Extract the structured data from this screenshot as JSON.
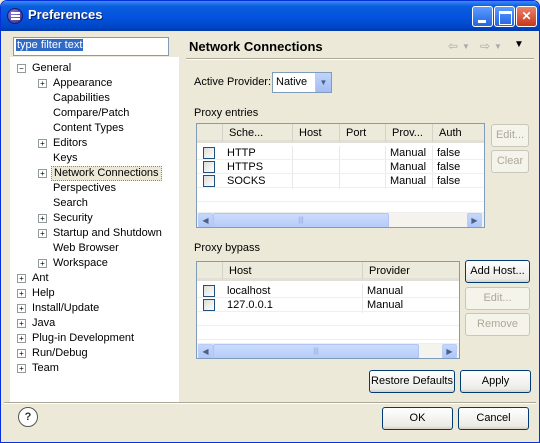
{
  "window": {
    "title": "Preferences"
  },
  "filter": {
    "value": "type filter text"
  },
  "tree": [
    {
      "label": "General",
      "expanded": true,
      "level": 0
    },
    {
      "label": "Appearance",
      "expandable": true,
      "level": 1
    },
    {
      "label": "Capabilities",
      "level": 1
    },
    {
      "label": "Compare/Patch",
      "level": 1
    },
    {
      "label": "Content Types",
      "level": 1
    },
    {
      "label": "Editors",
      "expandable": true,
      "level": 1
    },
    {
      "label": "Keys",
      "level": 1
    },
    {
      "label": "Network Connections",
      "expandable": true,
      "level": 1,
      "selected": true
    },
    {
      "label": "Perspectives",
      "level": 1
    },
    {
      "label": "Search",
      "level": 1
    },
    {
      "label": "Security",
      "expandable": true,
      "level": 1
    },
    {
      "label": "Startup and Shutdown",
      "expandable": true,
      "level": 1
    },
    {
      "label": "Web Browser",
      "level": 1
    },
    {
      "label": "Workspace",
      "expandable": true,
      "level": 1
    },
    {
      "label": "Ant",
      "expandable": true,
      "level": 0
    },
    {
      "label": "Help",
      "expandable": true,
      "level": 0
    },
    {
      "label": "Install/Update",
      "expandable": true,
      "level": 0
    },
    {
      "label": "Java",
      "expandable": true,
      "level": 0
    },
    {
      "label": "Plug-in Development",
      "expandable": true,
      "level": 0
    },
    {
      "label": "Run/Debug",
      "expandable": true,
      "level": 0
    },
    {
      "label": "Team",
      "expandable": true,
      "level": 0
    }
  ],
  "page": {
    "title": "Network Connections",
    "active_provider_label": "Active Provider:",
    "active_provider_value": "Native",
    "proxy_entries_label": "Proxy entries",
    "proxy_bypass_label": "Proxy bypass"
  },
  "proxy_entries": {
    "columns": [
      "Sche...",
      "Host",
      "Port",
      "Prov...",
      "Auth"
    ],
    "rows": [
      {
        "scheme": "HTTP",
        "host": "",
        "port": "",
        "provider": "Manual",
        "auth": "false"
      },
      {
        "scheme": "HTTPS",
        "host": "",
        "port": "",
        "provider": "Manual",
        "auth": "false"
      },
      {
        "scheme": "SOCKS",
        "host": "",
        "port": "",
        "provider": "Manual",
        "auth": "false"
      }
    ],
    "edit_label": "Edit...",
    "clear_label": "Clear"
  },
  "proxy_bypass": {
    "columns": [
      "Host",
      "Provider"
    ],
    "rows": [
      {
        "host": "localhost",
        "provider": "Manual"
      },
      {
        "host": "127.0.0.1",
        "provider": "Manual"
      }
    ],
    "add_label": "Add Host...",
    "edit_label": "Edit...",
    "remove_label": "Remove"
  },
  "buttons": {
    "restore_defaults": "Restore Defaults",
    "apply": "Apply",
    "ok": "OK",
    "cancel": "Cancel"
  },
  "icons": {
    "help": "?",
    "scroll_left": "◀",
    "scroll_right": "▶",
    "dropdown": "▼",
    "nav_back": "⇦",
    "nav_forward": "⇨"
  }
}
